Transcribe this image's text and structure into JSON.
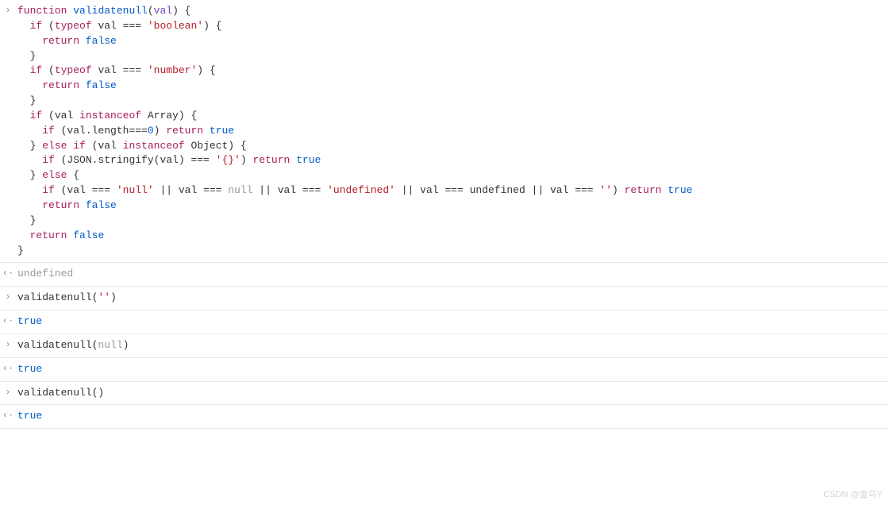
{
  "entries": [
    {
      "type": "input",
      "lines": [
        [
          {
            "t": "function",
            "c": "tok-kw"
          },
          {
            "t": " "
          },
          {
            "t": "validatenull",
            "c": "tok-fn"
          },
          {
            "t": "("
          },
          {
            "t": "val",
            "c": "tok-param"
          },
          {
            "t": ") {"
          }
        ],
        [
          {
            "t": "  "
          },
          {
            "t": "if",
            "c": "tok-kw"
          },
          {
            "t": " ("
          },
          {
            "t": "typeof",
            "c": "tok-kw"
          },
          {
            "t": " val === "
          },
          {
            "t": "'boolean'",
            "c": "tok-str"
          },
          {
            "t": ") {"
          }
        ],
        [
          {
            "t": "    "
          },
          {
            "t": "return",
            "c": "tok-kw"
          },
          {
            "t": " "
          },
          {
            "t": "false",
            "c": "tok-bool"
          }
        ],
        [
          {
            "t": "  }"
          }
        ],
        [
          {
            "t": "  "
          },
          {
            "t": "if",
            "c": "tok-kw"
          },
          {
            "t": " ("
          },
          {
            "t": "typeof",
            "c": "tok-kw"
          },
          {
            "t": " val === "
          },
          {
            "t": "'number'",
            "c": "tok-str"
          },
          {
            "t": ") {"
          }
        ],
        [
          {
            "t": "    "
          },
          {
            "t": "return",
            "c": "tok-kw"
          },
          {
            "t": " "
          },
          {
            "t": "false",
            "c": "tok-bool"
          }
        ],
        [
          {
            "t": "  }"
          }
        ],
        [
          {
            "t": "  "
          },
          {
            "t": "if",
            "c": "tok-kw"
          },
          {
            "t": " (val "
          },
          {
            "t": "instanceof",
            "c": "tok-kw"
          },
          {
            "t": " Array) {"
          }
        ],
        [
          {
            "t": "    "
          },
          {
            "t": "if",
            "c": "tok-kw"
          },
          {
            "t": " (val.length==="
          },
          {
            "t": "0",
            "c": "tok-bool"
          },
          {
            "t": ") "
          },
          {
            "t": "return",
            "c": "tok-kw"
          },
          {
            "t": " "
          },
          {
            "t": "true",
            "c": "tok-bool"
          }
        ],
        [
          {
            "t": "  } "
          },
          {
            "t": "else",
            "c": "tok-kw"
          },
          {
            "t": " "
          },
          {
            "t": "if",
            "c": "tok-kw"
          },
          {
            "t": " (val "
          },
          {
            "t": "instanceof",
            "c": "tok-kw"
          },
          {
            "t": " Object) {"
          }
        ],
        [
          {
            "t": "    "
          },
          {
            "t": "if",
            "c": "tok-kw"
          },
          {
            "t": " (JSON.stringify(val) === "
          },
          {
            "t": "'{}'",
            "c": "tok-str"
          },
          {
            "t": ") "
          },
          {
            "t": "return",
            "c": "tok-kw"
          },
          {
            "t": " "
          },
          {
            "t": "true",
            "c": "tok-bool"
          }
        ],
        [
          {
            "t": "  } "
          },
          {
            "t": "else",
            "c": "tok-kw"
          },
          {
            "t": " {"
          }
        ],
        [
          {
            "t": "    "
          },
          {
            "t": "if",
            "c": "tok-kw"
          },
          {
            "t": " (val === "
          },
          {
            "t": "'null'",
            "c": "tok-str"
          },
          {
            "t": " || val === "
          },
          {
            "t": "null",
            "c": "tok-null"
          },
          {
            "t": " || val === "
          },
          {
            "t": "'undefined'",
            "c": "tok-str"
          },
          {
            "t": " || val === undefined || val === "
          },
          {
            "t": "''",
            "c": "tok-str"
          },
          {
            "t": ") "
          },
          {
            "t": "return",
            "c": "tok-kw"
          },
          {
            "t": " "
          },
          {
            "t": "true",
            "c": "tok-bool"
          }
        ],
        [
          {
            "t": "    "
          },
          {
            "t": "return",
            "c": "tok-kw"
          },
          {
            "t": " "
          },
          {
            "t": "false",
            "c": "tok-bool"
          }
        ],
        [
          {
            "t": "  }"
          }
        ],
        [
          {
            "t": "  "
          },
          {
            "t": "return",
            "c": "tok-kw"
          },
          {
            "t": " "
          },
          {
            "t": "false",
            "c": "tok-bool"
          }
        ],
        [
          {
            "t": "}"
          }
        ]
      ]
    },
    {
      "type": "output",
      "lines": [
        [
          {
            "t": "undefined",
            "c": "undef"
          }
        ]
      ]
    },
    {
      "type": "input",
      "lines": [
        [
          {
            "t": "validatenull("
          },
          {
            "t": "''",
            "c": "tok-str"
          },
          {
            "t": ")"
          }
        ]
      ]
    },
    {
      "type": "output",
      "lines": [
        [
          {
            "t": "true",
            "c": "tok-bool"
          }
        ]
      ]
    },
    {
      "type": "input",
      "lines": [
        [
          {
            "t": "validatenull("
          },
          {
            "t": "null",
            "c": "tok-null"
          },
          {
            "t": ")"
          }
        ]
      ]
    },
    {
      "type": "output",
      "lines": [
        [
          {
            "t": "true",
            "c": "tok-bool"
          }
        ]
      ]
    },
    {
      "type": "input",
      "lines": [
        [
          {
            "t": "validatenull()"
          }
        ]
      ]
    },
    {
      "type": "output",
      "lines": [
        [
          {
            "t": "true",
            "c": "tok-bool"
          }
        ]
      ]
    }
  ],
  "glyphs": {
    "input": "›",
    "output": "‹·"
  },
  "watermark": "CSDN @金乌Y"
}
